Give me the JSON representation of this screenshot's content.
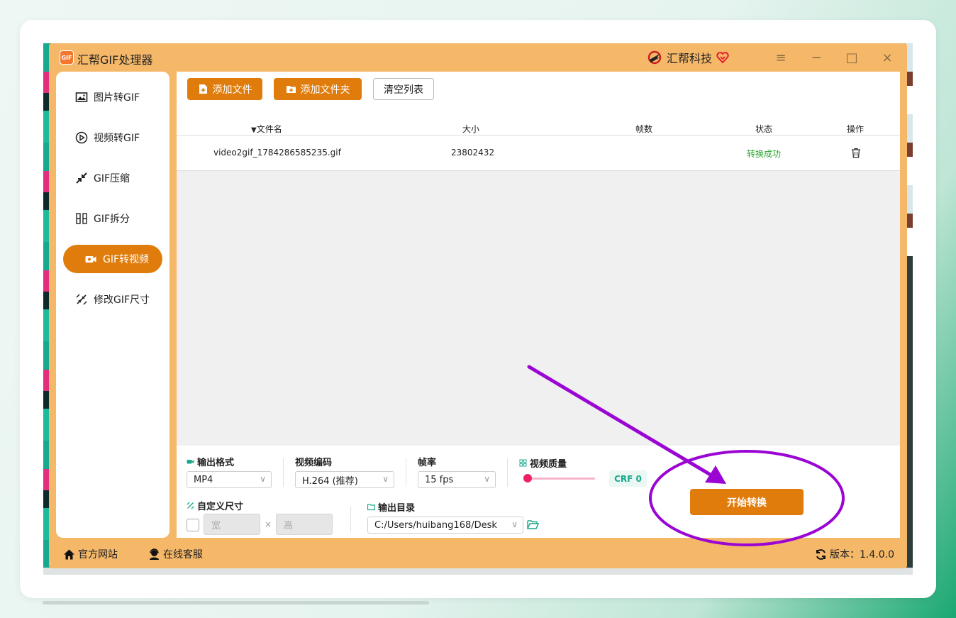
{
  "app": {
    "title": "汇帮GIF处理器",
    "logo_text": "GIF",
    "brand": "汇帮科技"
  },
  "window_controls": [
    {
      "name": "menu-icon",
      "glyph": "≡"
    },
    {
      "name": "minimize-icon",
      "glyph": "−"
    },
    {
      "name": "maximize-icon",
      "glyph": "□"
    },
    {
      "name": "close-icon",
      "glyph": "×"
    }
  ],
  "sidebar": {
    "items": [
      {
        "label": "图片转GIF",
        "icon": "image-icon",
        "active": false
      },
      {
        "label": "视频转GIF",
        "icon": "play-circle-icon",
        "active": false
      },
      {
        "label": "GIF压缩",
        "icon": "compress-icon",
        "active": false
      },
      {
        "label": "GIF拆分",
        "icon": "split-icon",
        "active": false
      },
      {
        "label": "GIF转视频",
        "icon": "video-camera-icon",
        "active": true
      },
      {
        "label": "修改GIF尺寸",
        "icon": "resize-icon",
        "active": false
      }
    ]
  },
  "toolbar": {
    "add_file": "添加文件",
    "add_folder": "添加文件夹",
    "clear_list": "清空列表"
  },
  "table": {
    "columns": [
      "文件名",
      "大小",
      "帧数",
      "状态",
      "操作"
    ],
    "sort_indicator": "▼",
    "rows": [
      {
        "filename": "video2gif_1784286585235.gif",
        "size": "23802432",
        "frames": "",
        "status": "转换成功",
        "action_icon": "trash-icon"
      }
    ]
  },
  "settings": {
    "output_format": {
      "label": "输出格式",
      "value": "MP4"
    },
    "video_codec": {
      "label": "视频编码",
      "value": "H.264 (推荐)"
    },
    "frame_rate": {
      "label": "帧率",
      "value": "15 fps"
    },
    "video_quality": {
      "label": "视频质量",
      "value_text": "CRF 0",
      "slider_fraction": 0
    },
    "custom_size": {
      "label": "自定义尺寸",
      "checked": false,
      "width_placeholder": "宽",
      "height_placeholder": "高",
      "separator": "×"
    },
    "output_dir": {
      "label": "输出目录",
      "value": "C:/Users/huibang168/Desk"
    },
    "start_button": "开始转换"
  },
  "footer": {
    "website": "官方网站",
    "support": "在线客服",
    "version": "版本：1.4.0.0"
  },
  "colors": {
    "accent": "#e07c0c",
    "frame": "#f5b869",
    "success": "#27a327",
    "annotation": "#9b05d4"
  }
}
